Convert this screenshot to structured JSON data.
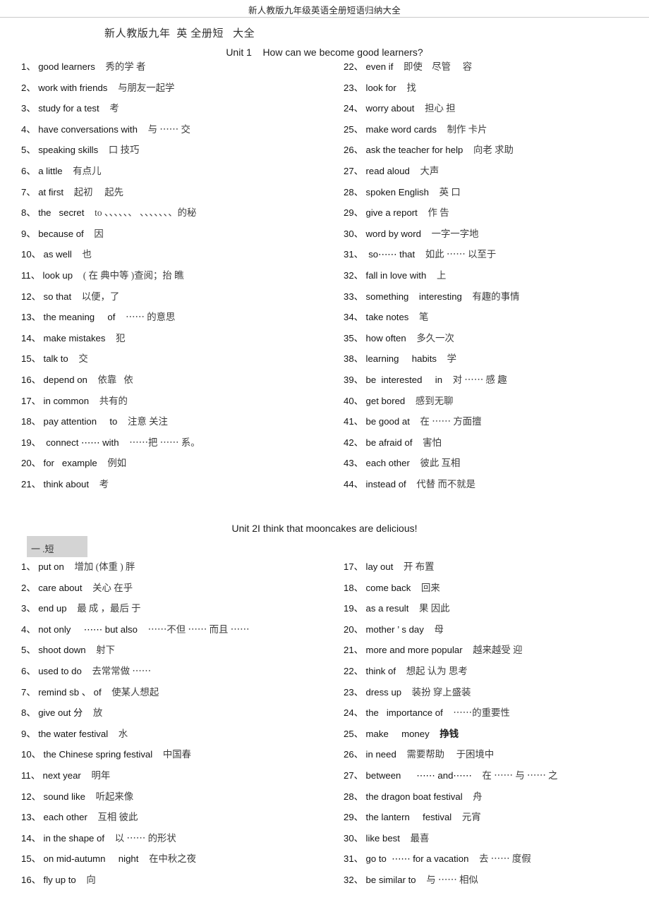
{
  "page": {
    "running_header": "新人教版九年级英语全册短语归纳大全",
    "doc_title": "新人教版九年  英 全册短   大全"
  },
  "units": [
    {
      "heading": "Unit 1    How can we become good learners?",
      "left_items": [
        {
          "num": "1、",
          "term": "good learners",
          "gloss": "秀的学 者"
        },
        {
          "num": "2、",
          "term": "work with friends",
          "gloss": "与朋友一起学"
        },
        {
          "num": "3、",
          "term": "study for a test",
          "gloss": "考"
        },
        {
          "num": "4、",
          "term": "have conversations with",
          "gloss": "与 ⋯⋯ 交"
        },
        {
          "num": "5、",
          "term": "speaking skills",
          "gloss": "口 技巧"
        },
        {
          "num": "6、",
          "term": "a little",
          "gloss": "有点儿"
        },
        {
          "num": "7、",
          "term": "at first",
          "gloss": "起初     起先"
        },
        {
          "num": "8、",
          "term": "the   secret",
          "gloss": "to 、、、、、、 、、、、、、、的秘"
        },
        {
          "num": "9、",
          "term": "because of",
          "gloss": "因"
        },
        {
          "num": "10、",
          "term": "as well",
          "gloss": "也"
        },
        {
          "num": "11、",
          "term": "look up",
          "gloss": "( 在 典中等 )查阅；抬 瞧"
        },
        {
          "num": "12、",
          "term": "so that",
          "gloss": "以便，了"
        },
        {
          "num": "13、",
          "term": "the meaning     of",
          "gloss": "⋯⋯ 的意思"
        },
        {
          "num": "14、",
          "term": "make mistakes",
          "gloss": "犯"
        },
        {
          "num": "15、",
          "term": "talk to",
          "gloss": "交"
        },
        {
          "num": "16、",
          "term": "depend on",
          "gloss": "依靠   依"
        },
        {
          "num": "17、",
          "term": "in common",
          "gloss": "共有的"
        },
        {
          "num": "18、",
          "term": "pay attention     to",
          "gloss": "注意 关注"
        },
        {
          "num": "19、",
          "term": " connect ⋯⋯ with",
          "gloss": "⋯⋯把 ⋯⋯ 系。"
        },
        {
          "num": "20、",
          "term": "for   example",
          "gloss": "例如"
        },
        {
          "num": "21、",
          "term": "think about",
          "gloss": "考"
        }
      ],
      "right_items": [
        {
          "num": "22、",
          "term": "even if",
          "gloss": "即使    尽管     容"
        },
        {
          "num": "23、",
          "term": "look for",
          "gloss": "找"
        },
        {
          "num": "24、",
          "term": "worry about",
          "gloss": "担心 担"
        },
        {
          "num": "25、",
          "term": "make word cards",
          "gloss": "制作 卡片"
        },
        {
          "num": "26、",
          "term": "ask the teacher for help",
          "gloss": "向老 求助"
        },
        {
          "num": "27、",
          "term": "read aloud",
          "gloss": "大声"
        },
        {
          "num": "28、",
          "term": "spoken English",
          "gloss": "英 口"
        },
        {
          "num": "29、",
          "term": "give a report",
          "gloss": "作 告"
        },
        {
          "num": "30、",
          "term": "word by word",
          "gloss": "一字一字地"
        },
        {
          "num": "31、",
          "term": " so⋯⋯ that",
          "gloss": "如此 ⋯⋯ 以至于"
        },
        {
          "num": "32、",
          "term": "fall in love with",
          "gloss": "上"
        },
        {
          "num": "33、",
          "term": "something    interesting",
          "gloss": "有趣的事情"
        },
        {
          "num": "34、",
          "term": "take notes",
          "gloss": "笔"
        },
        {
          "num": "35、",
          "term": "how often",
          "gloss": "多久一次"
        },
        {
          "num": "38、",
          "term": "learning     habits",
          "gloss": "学"
        },
        {
          "num": "39、",
          "term": "be  interested     in",
          "gloss": "对 ⋯⋯ 感 趣",
          "gloss_bold": false
        },
        {
          "num": "40、",
          "term": "get bored",
          "gloss": "感到无聊"
        },
        {
          "num": "41、",
          "term": "be good at",
          "gloss": "在 ⋯⋯ 方面擅"
        },
        {
          "num": "42、",
          "term": "be afraid of",
          "gloss": "害怕"
        },
        {
          "num": "43、",
          "term": "each other",
          "gloss": "彼此 互相"
        },
        {
          "num": "44、",
          "term": "instead of",
          "gloss": "代替 而不就是"
        }
      ]
    },
    {
      "heading": "Unit 2I think that mooncakes are delicious!",
      "section_label": "一 .短",
      "left_items": [
        {
          "num": "1、",
          "term": "put on",
          "gloss": "增加 (体重 ) 胖"
        },
        {
          "num": "2、",
          "term": "care about",
          "gloss": "关心 在乎"
        },
        {
          "num": "3、",
          "term": "end up",
          "gloss": "最 成 ，最后 于"
        },
        {
          "num": "4、",
          "term": "not only     ⋯⋯ but also",
          "gloss": "⋯⋯不但 ⋯⋯ 而且 ⋯⋯"
        },
        {
          "num": "5、",
          "term": "shoot down",
          "gloss": "射下"
        },
        {
          "num": "6、",
          "term": "used to do",
          "gloss": "去常常做 ⋯⋯"
        },
        {
          "num": "7、",
          "term": "remind sb 、 of",
          "gloss": "使某人想起"
        },
        {
          "num": "8、",
          "term": "give out 分",
          "gloss": "放"
        },
        {
          "num": "9、",
          "term": "the water festival",
          "gloss": "水"
        },
        {
          "num": "10、",
          "term": "the Chinese spring festival",
          "gloss": "中国春"
        },
        {
          "num": "11、",
          "term": "next year",
          "gloss": "明年"
        },
        {
          "num": "12、",
          "term": "sound like",
          "gloss": "听起来像"
        },
        {
          "num": "13、",
          "term": "each other",
          "gloss": "互相 彼此"
        },
        {
          "num": "14、",
          "term": "in the shape of",
          "gloss": "以 ⋯⋯ 的形状"
        },
        {
          "num": "15、",
          "term": "on mid-autumn     night",
          "gloss": "在中秋之夜"
        },
        {
          "num": "16、",
          "term": "fly up to",
          "gloss": "向"
        }
      ],
      "right_items": [
        {
          "num": "17、",
          "term": "lay out",
          "gloss": "开 布置"
        },
        {
          "num": "18、",
          "term": "come back",
          "gloss": "回来"
        },
        {
          "num": "19、",
          "term": "as a result",
          "gloss": "果 因此"
        },
        {
          "num": "20、",
          "term": "mother ’ s day",
          "gloss": "母"
        },
        {
          "num": "21、",
          "term": "more and more popular",
          "gloss": "越来越受 迎"
        },
        {
          "num": "22、",
          "term": "think of",
          "gloss": "想起 认为 思考"
        },
        {
          "num": "23、",
          "term": "dress up",
          "gloss": "装扮 穿上盛装"
        },
        {
          "num": "24、",
          "term": "the   importance of",
          "gloss": "⋯⋯的重要性"
        },
        {
          "num": "25、",
          "term": "make     money",
          "gloss": "挣钱",
          "gloss_bold": true
        },
        {
          "num": "26、",
          "term": "in need",
          "gloss": "需要帮助     于困境中"
        },
        {
          "num": "27、",
          "term": "between      ⋯⋯ and⋯⋯",
          "gloss": "在 ⋯⋯ 与 ⋯⋯ 之"
        },
        {
          "num": "28、",
          "term": "the dragon boat festival",
          "gloss": "舟"
        },
        {
          "num": "29、",
          "term": "the lantern     festival",
          "gloss": "元宵"
        },
        {
          "num": "30、",
          "term": "like best",
          "gloss": "最喜"
        },
        {
          "num": "31、",
          "term": "go to  ⋯⋯ for a vacation",
          "gloss": "去 ⋯⋯ 度假"
        },
        {
          "num": "32、",
          "term": "be similar to",
          "gloss": "与 ⋯⋯ 相似"
        }
      ]
    }
  ]
}
